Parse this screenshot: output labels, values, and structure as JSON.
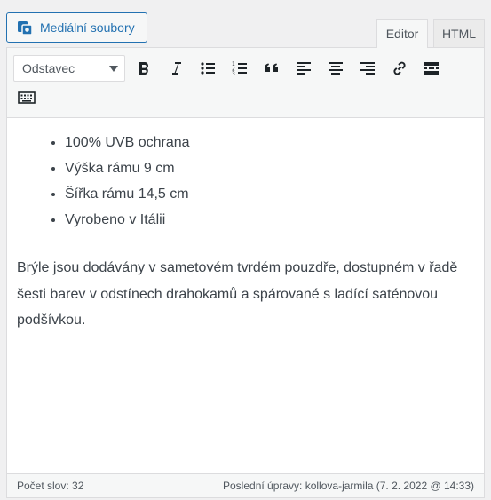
{
  "media_button": {
    "label": "Mediální soubory",
    "icon": "media-icon"
  },
  "tabs": {
    "editor": "Editor",
    "html": "HTML"
  },
  "toolbar": {
    "format_select": "Odstavec",
    "buttons": [
      "bold-icon",
      "italic-icon",
      "bullet-list-icon",
      "numbered-list-icon",
      "blockquote-icon",
      "align-left-icon",
      "align-center-icon",
      "align-right-icon",
      "link-icon",
      "read-more-icon",
      "toolbar-toggle-icon"
    ]
  },
  "content": {
    "list": [
      "100% UVB ochrana",
      "Výška rámu 9 cm",
      "Šířka rámu 14,5 cm",
      "Vyrobeno v Itálii"
    ],
    "paragraph": "Brýle jsou dodávány v sametovém tvrdém pouzdře, dostupném v řadě šesti barev v odstínech drahokamů a spárované s ladící saténovou podšívkou."
  },
  "status": {
    "word_count": "Počet slov: 32",
    "last_edit": "Poslední úpravy: kollova-jarmila (7. 2. 2022 @ 14:33)"
  },
  "colors": {
    "accent": "#2271b1",
    "toolbar_bg": "#f6f7f7",
    "border": "#dcdcde"
  }
}
